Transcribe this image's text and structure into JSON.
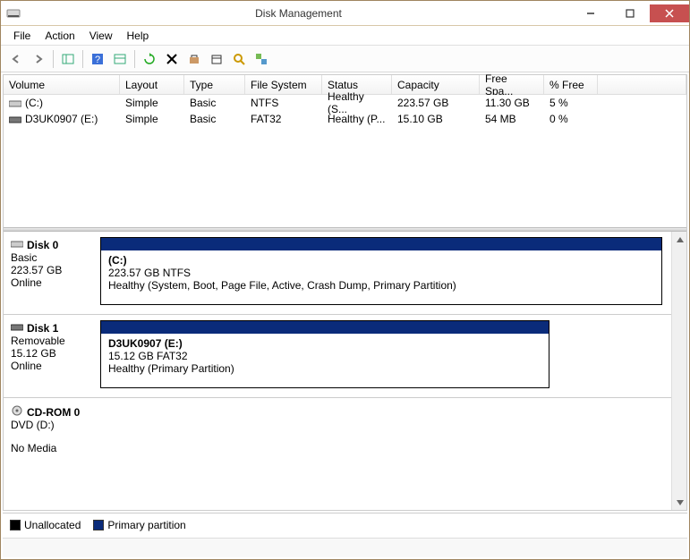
{
  "window_title": "Disk Management",
  "menu": {
    "file": "File",
    "action": "Action",
    "view": "View",
    "help": "Help"
  },
  "toolbar_icons": [
    "back",
    "forward",
    "up-level",
    "help",
    "properties",
    "refresh",
    "delete",
    "settings",
    "explore",
    "find",
    "console"
  ],
  "columns": {
    "volume": "Volume",
    "layout": "Layout",
    "type": "Type",
    "fs": "File System",
    "status": "Status",
    "capacity": "Capacity",
    "free": "Free Spa...",
    "pct": "% Free"
  },
  "volumes": [
    {
      "name": "(C:)",
      "layout": "Simple",
      "type": "Basic",
      "fs": "NTFS",
      "status": "Healthy (S...",
      "capacity": "223.57 GB",
      "free": "11.30 GB",
      "pct": "5 %"
    },
    {
      "name": "D3UK0907 (E:)",
      "layout": "Simple",
      "type": "Basic",
      "fs": "FAT32",
      "status": "Healthy (P...",
      "capacity": "15.10 GB",
      "free": "54 MB",
      "pct": "0 %"
    }
  ],
  "disks": [
    {
      "name": "Disk 0",
      "kind": "Basic",
      "size": "223.57 GB",
      "state": "Online",
      "partition": {
        "label": "(C:)",
        "detail": "223.57 GB NTFS",
        "status": "Healthy (System, Boot, Page File, Active, Crash Dump, Primary Partition)"
      },
      "width_pct": 100
    },
    {
      "name": "Disk 1",
      "kind": "Removable",
      "size": "15.12 GB",
      "state": "Online",
      "partition": {
        "label": "D3UK0907  (E:)",
        "detail": "15.12 GB FAT32",
        "status": "Healthy (Primary Partition)"
      },
      "width_pct": 80
    },
    {
      "name": "CD-ROM 0",
      "kind": "DVD (D:)",
      "size": "",
      "state": "No Media",
      "partition": null
    }
  ],
  "legend": {
    "unallocated": "Unallocated",
    "primary": "Primary partition"
  }
}
